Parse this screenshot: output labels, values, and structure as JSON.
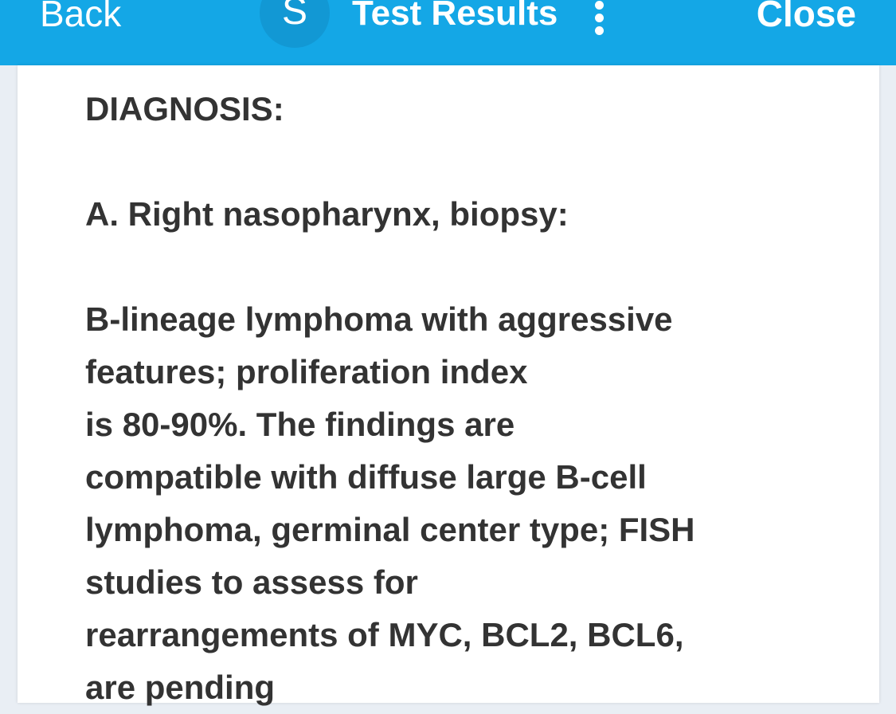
{
  "header": {
    "back_label": "Back",
    "logo_letter": "S",
    "title": "Test Results",
    "close_label": "Close",
    "menu_icon": "vertical-ellipsis-icon"
  },
  "report": {
    "heading": "DIAGNOSIS:",
    "specimen": "A. Right nasopharynx, biopsy:",
    "lines": [
      "B-lineage lymphoma with aggressive",
      "features; proliferation index",
      "is 80-90%. The findings are",
      "compatible with diffuse large B-cell",
      "lymphoma, germinal center type; FISH",
      "studies to assess for",
      "rearrangements of MYC, BCL2, BCL6,",
      "are pending"
    ]
  },
  "colors": {
    "header_bg": "#14a7e6",
    "logo_bg": "#1298d4",
    "text": "#333333",
    "page_bg": "#e9eef4"
  }
}
